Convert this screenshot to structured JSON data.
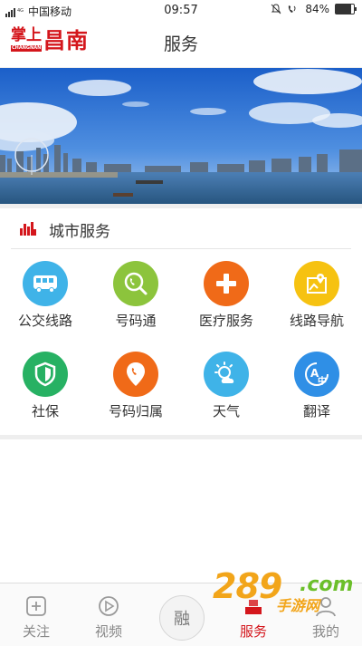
{
  "status_bar": {
    "carrier": "中国移动",
    "time": "09:57",
    "battery": "84%",
    "battery_level": 0.84
  },
  "header": {
    "logo_small": "掌上",
    "logo_big": "昌南",
    "logo_sub": "CHANGNAN",
    "title": "服务"
  },
  "section": {
    "title": "城市服务"
  },
  "services": [
    {
      "label": "公交线路",
      "icon": "bus-icon",
      "color": "#3fb3e8"
    },
    {
      "label": "号码通",
      "icon": "phone-search-icon",
      "color": "#8cc43c"
    },
    {
      "label": "医疗服务",
      "icon": "medical-cross-icon",
      "color": "#f06a18"
    },
    {
      "label": "线路导航",
      "icon": "map-pin-icon",
      "color": "#f6c211"
    },
    {
      "label": "社保",
      "icon": "shield-icon",
      "color": "#27b163"
    },
    {
      "label": "号码归属",
      "icon": "phone-location-icon",
      "color": "#f06a18"
    },
    {
      "label": "天气",
      "icon": "weather-icon",
      "color": "#3fb3e8"
    },
    {
      "label": "翻译",
      "icon": "translate-icon",
      "color": "#2f8fe6"
    }
  ],
  "tabbar": {
    "tabs": [
      {
        "label": "关注",
        "icon": "add-follow-icon"
      },
      {
        "label": "视频",
        "icon": "play-icon"
      },
      {
        "label": "",
        "icon": "rong-icon"
      },
      {
        "label": "服务",
        "icon": "service-icon",
        "active": true
      },
      {
        "label": "我的",
        "icon": "profile-icon"
      }
    ],
    "center_label": "融",
    "active_color": "#d4161c"
  },
  "watermark": {
    "number": "289",
    "domain": ".com",
    "text": "手游网"
  }
}
